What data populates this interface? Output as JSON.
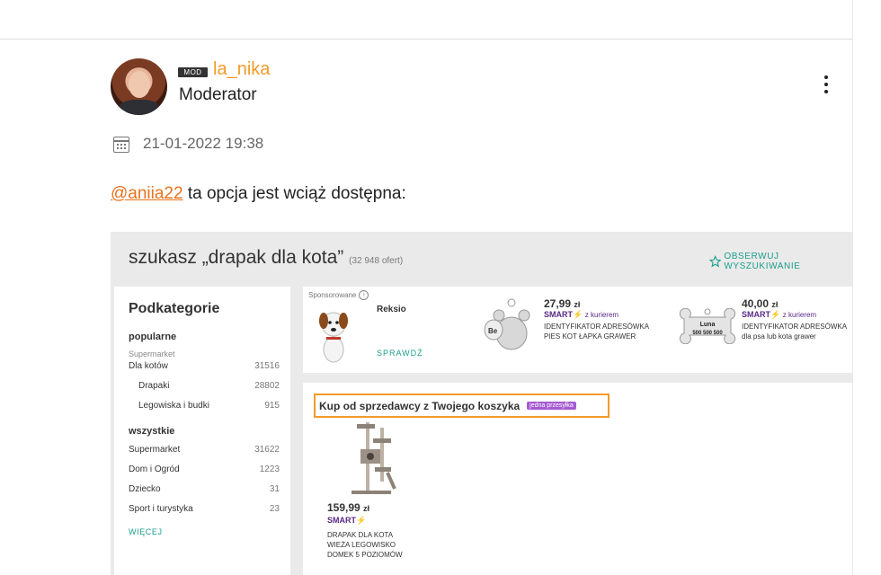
{
  "post": {
    "badge": "MOD",
    "username": "la_nika",
    "role": "Moderator",
    "date": "21-01-2022 19:38",
    "mention": "@aniia22",
    "message": " ta opcja jest wciąż dostępna:"
  },
  "screenshot": {
    "title": "szukasz „drapak dla kota”",
    "offers": "(32 948 ofert)",
    "follow": "OBSERWUJ WYSZUKIWANIE",
    "sidebar": {
      "heading": "Podkategorie",
      "popular_label": "popularne",
      "popular_group": "Supermarket",
      "popular": [
        {
          "name": "Dla kotów",
          "count": "31516",
          "indent": false
        },
        {
          "name": "Drapaki",
          "count": "28802",
          "indent": true
        },
        {
          "name": "Legowiska i budki",
          "count": "915",
          "indent": true
        }
      ],
      "all_label": "wszystkie",
      "all": [
        {
          "name": "Supermarket",
          "count": "31622"
        },
        {
          "name": "Dom i Ogród",
          "count": "1223"
        },
        {
          "name": "Dziecko",
          "count": "31"
        },
        {
          "name": "Sport i turystyka",
          "count": "23"
        }
      ],
      "more": "WIĘCEJ"
    },
    "sponsored": {
      "label": "Sponsorowane",
      "info": "i",
      "brand": "Reksio",
      "check": "SPRAWDŹ",
      "products": [
        {
          "price": "27,99",
          "currency": "zł",
          "smart": "SMART",
          "courier": "z kurierem",
          "desc1": "IDENTYFIKATOR ADRESÓWKA",
          "desc2": "PIES KOT ŁAPKA GRAWER",
          "tag_text": "Be"
        },
        {
          "price": "40,00",
          "currency": "zł",
          "smart": "SMART",
          "courier": "z kurierem",
          "desc1": "IDENTYFIKATOR ADRESÓWKA",
          "desc2": "dla psa lub kota grawer",
          "tag_name": "Luna",
          "tag_phone": "500 500 500"
        }
      ]
    },
    "seller": {
      "title": "Kup od sprzedawcy z Twojego koszyka",
      "badge": "jedna przesyłka",
      "price": "159,99",
      "currency": "zł",
      "smart": "SMART",
      "desc1": "DRAPAK DLA KOTA",
      "desc2": "WIEŻA LEGOWISKO",
      "desc3": "DOMEK 5 POZIOMÓW"
    }
  },
  "colors": {
    "accent_orange": "#f39a2a",
    "mention": "#e8711c",
    "teal": "#1a9e8c",
    "smart_purple": "#5a2a86"
  }
}
